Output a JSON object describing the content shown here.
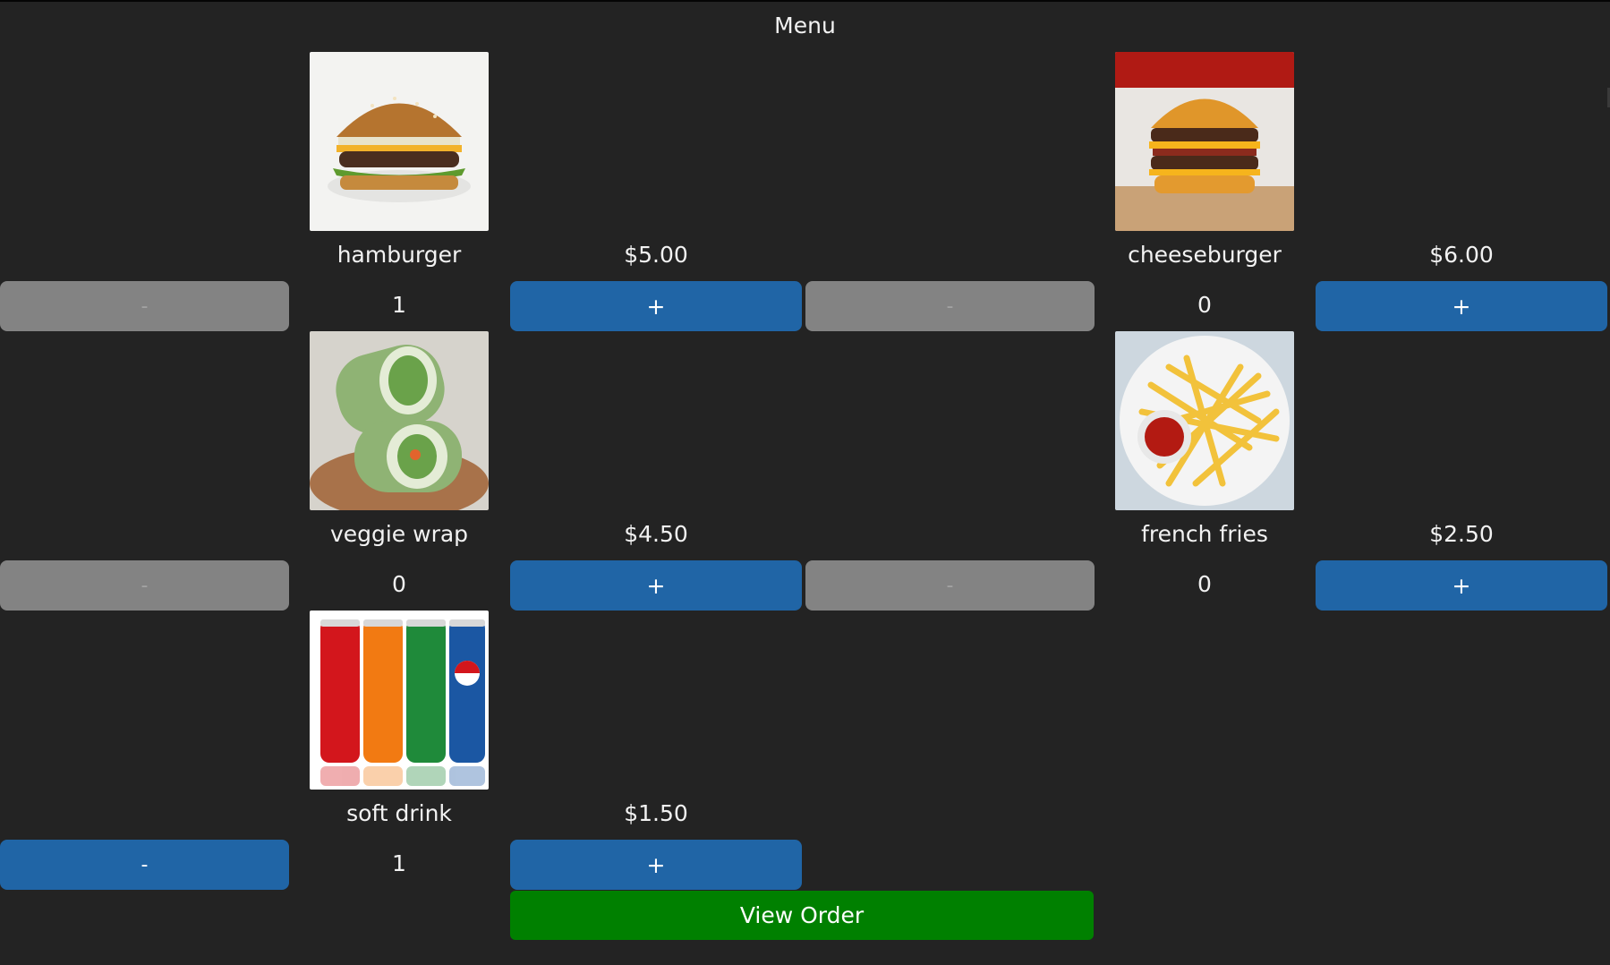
{
  "title": "Menu",
  "minus_label": "-",
  "plus_label": "+",
  "view_order_label": "View Order",
  "colors": {
    "background": "#232323",
    "primary_button": "#2065a6",
    "disabled_button": "#838383",
    "view_order_button": "#008000"
  },
  "items": [
    {
      "name": "hamburger",
      "price": "$5.00",
      "count": "1",
      "minus_enabled": false,
      "image_icon": "hamburger-photo"
    },
    {
      "name": "cheeseburger",
      "price": "$6.00",
      "count": "0",
      "minus_enabled": false,
      "image_icon": "cheeseburger-photo"
    },
    {
      "name": "veggie wrap",
      "price": "$4.50",
      "count": "0",
      "minus_enabled": false,
      "image_icon": "veggie-wrap-photo"
    },
    {
      "name": "french fries",
      "price": "$2.50",
      "count": "0",
      "minus_enabled": false,
      "image_icon": "french-fries-photo"
    },
    {
      "name": "soft drink",
      "price": "$1.50",
      "count": "1",
      "minus_enabled": true,
      "image_icon": "soft-drink-photo"
    }
  ]
}
